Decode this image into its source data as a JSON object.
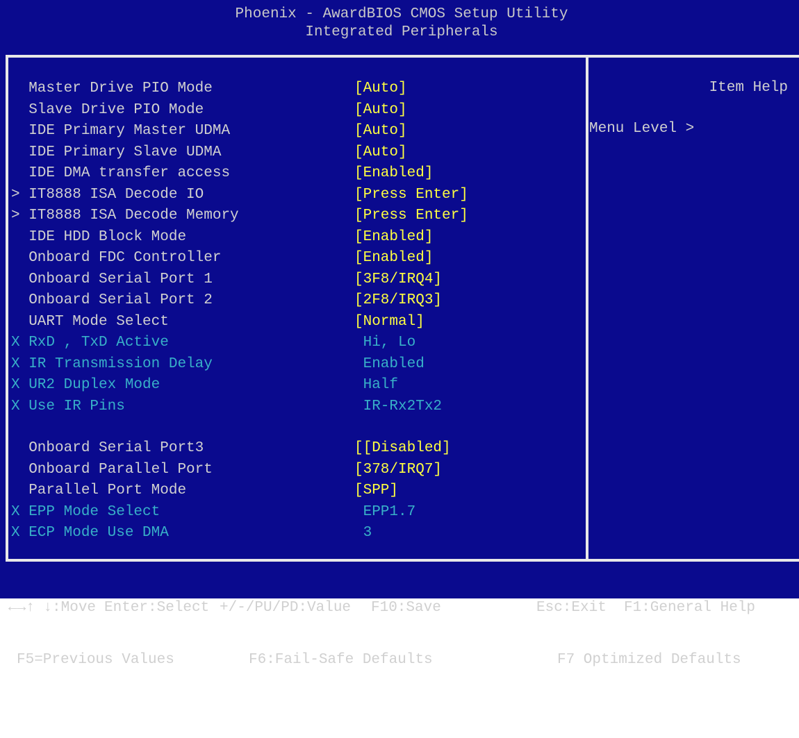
{
  "title": {
    "line1": "Phoenix - AwardBIOS CMOS Setup Utility",
    "line2": "Integrated Peripherals"
  },
  "items": [
    {
      "label": "  Master Drive PIO Mode",
      "value": "[Auto]",
      "state": "active"
    },
    {
      "label": "  Slave Drive PIO Mode",
      "value": "[Auto]",
      "state": "active"
    },
    {
      "label": "  IDE Primary Master UDMA",
      "value": "[Auto]",
      "state": "active"
    },
    {
      "label": "  IDE Primary Slave UDMA",
      "value": "[Auto]",
      "state": "active"
    },
    {
      "label": "  IDE DMA transfer access",
      "value": "[Enabled]",
      "state": "active"
    },
    {
      "label": "> IT8888 ISA Decode IO",
      "value": "[Press Enter]",
      "state": "active"
    },
    {
      "label": "> IT8888 ISA Decode Memory",
      "value": "[Press Enter]",
      "state": "active"
    },
    {
      "label": "  IDE HDD Block Mode",
      "value": "[Enabled]",
      "state": "active"
    },
    {
      "label": "  Onboard FDC Controller",
      "value": "[Enabled]",
      "state": "active"
    },
    {
      "label": "  Onboard Serial Port 1",
      "value": "[3F8/IRQ4]",
      "state": "active"
    },
    {
      "label": "  Onboard Serial Port 2",
      "value": "[2F8/IRQ3]",
      "state": "active"
    },
    {
      "label": "  UART Mode Select",
      "value": "[Normal]",
      "state": "active"
    },
    {
      "label": "X RxD , TxD Active",
      "value": " Hi, Lo",
      "state": "disabled"
    },
    {
      "label": "X IR Transmission Delay",
      "value": " Enabled",
      "state": "disabled"
    },
    {
      "label": "X UR2 Duplex Mode",
      "value": " Half",
      "state": "disabled"
    },
    {
      "label": "X Use IR Pins",
      "value": " IR-Rx2Tx2",
      "state": "disabled"
    },
    {
      "label": "  Onboard Serial Port3",
      "value": "[[Disabled]",
      "state": "active"
    },
    {
      "label": "  Onboard Parallel Port",
      "value": "[378/IRQ7]",
      "state": "active"
    },
    {
      "label": "  Parallel Port Mode",
      "value": "[SPP]",
      "state": "active"
    },
    {
      "label": "X EPP Mode Select",
      "value": " EPP1.7",
      "state": "disabled"
    },
    {
      "label": "X ECP Mode Use DMA",
      "value": " 3",
      "state": "disabled"
    }
  ],
  "help": {
    "title": "Item Help",
    "menu_level": "Menu Level >"
  },
  "footer": {
    "move": "←→↑ ↓:Move",
    "select": "Enter:Select",
    "value": "+/-/PU/PD:Value",
    "save": "F10:Save",
    "exit": "Esc:Exit",
    "general_help": "F1:General Help",
    "previous": "F5=Previous Values",
    "failsafe": "F6:Fail-Safe Defaults",
    "optimized": "F7 Optimized Defaults"
  },
  "colors": {
    "background": "#0a0a8e",
    "value": "#ffff40",
    "disabled": "#38b0c8",
    "text": "#d0d0d0"
  }
}
